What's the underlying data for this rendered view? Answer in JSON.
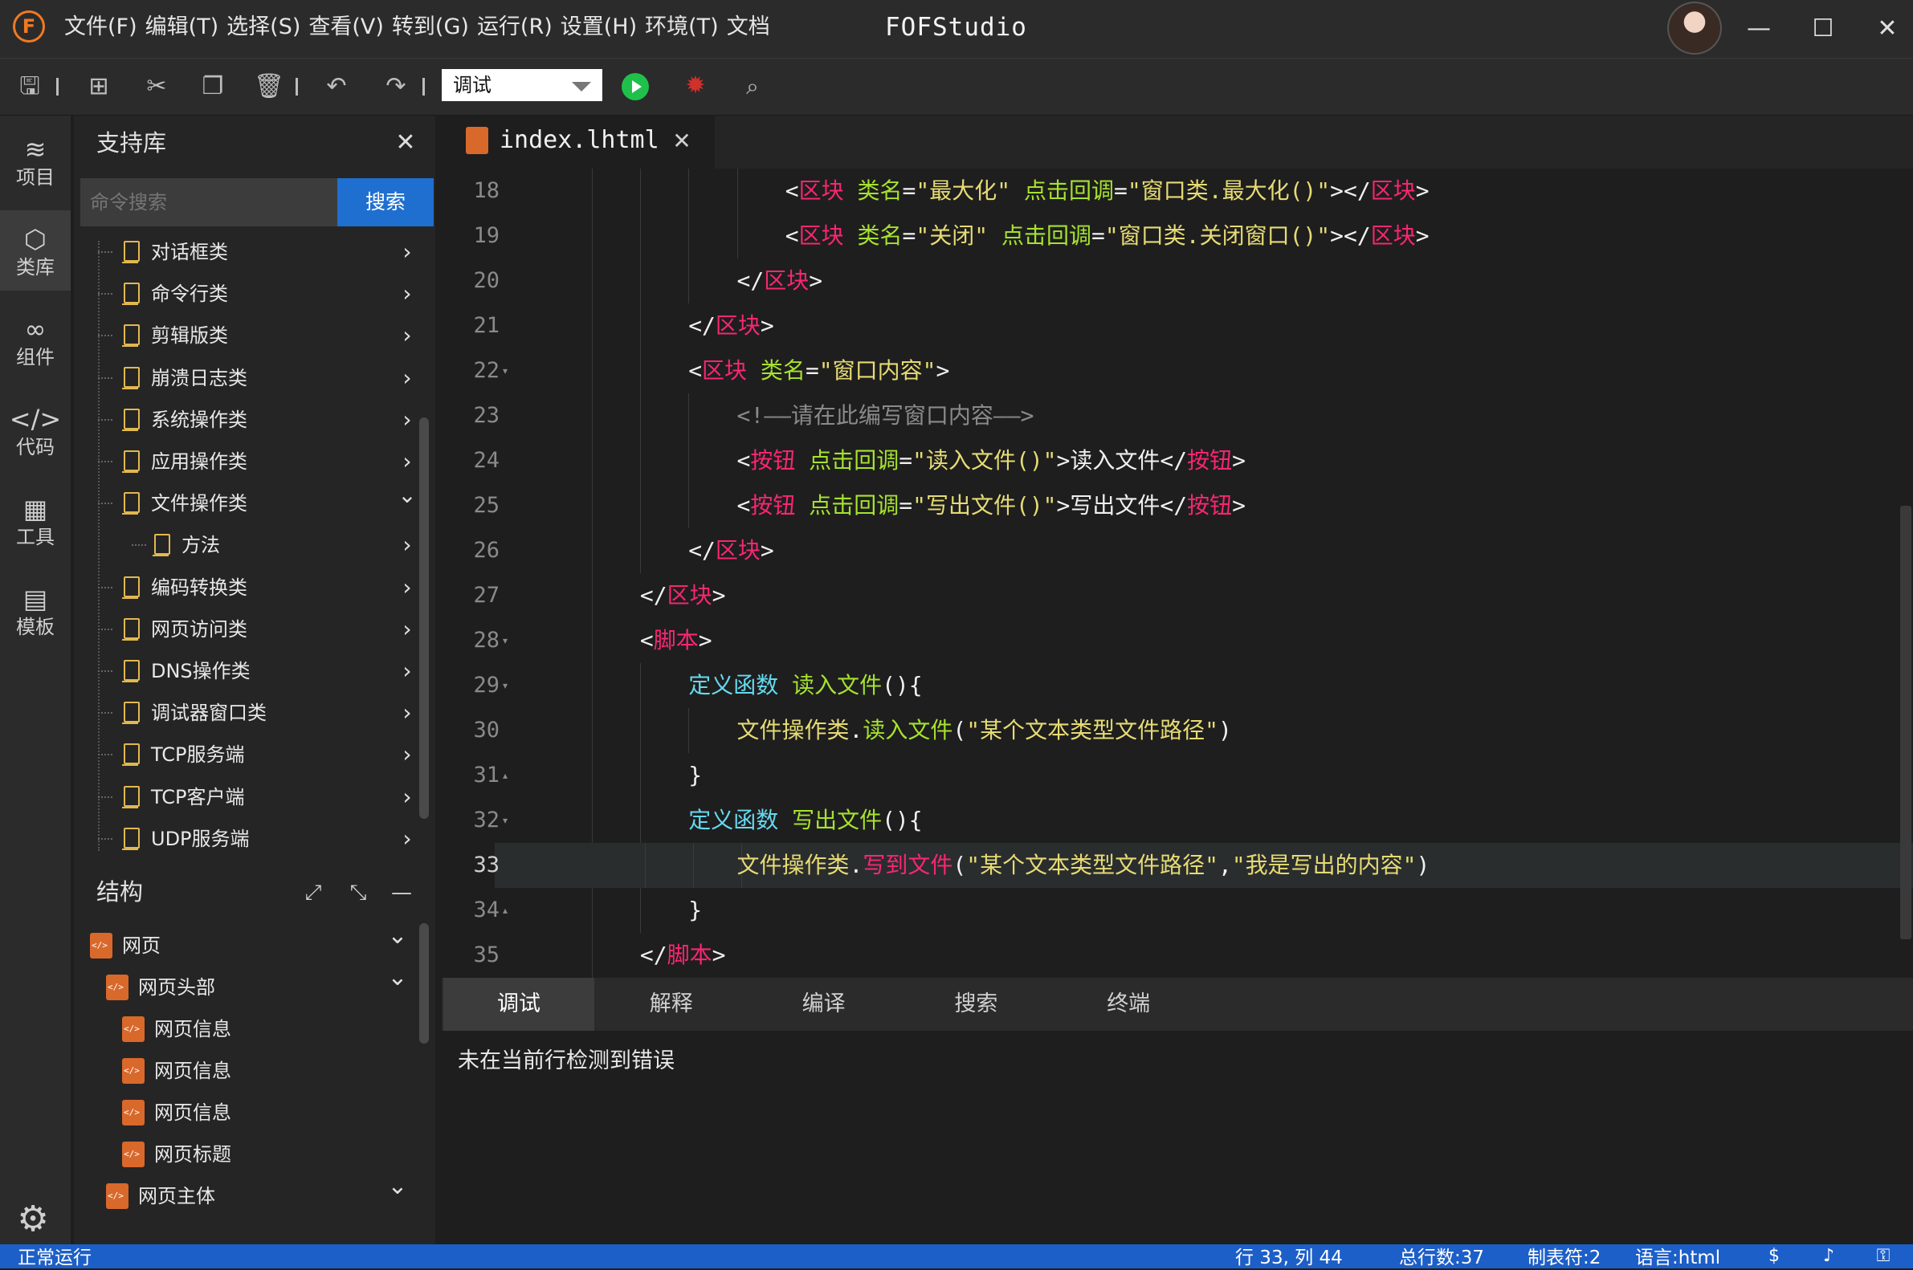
{
  "app": {
    "logo_letter": "F",
    "title": "FOFStudio",
    "menu": [
      "文件(F)",
      "编辑(T)",
      "选择(S)",
      "查看(V)",
      "转到(G)",
      "运行(R)",
      "设置(H)",
      "环境(T)",
      "文档"
    ]
  },
  "toolbar": {
    "run_mode": "调试"
  },
  "activity": [
    {
      "label": "项目",
      "icon": "layers-icon"
    },
    {
      "label": "类库",
      "icon": "cube-icon"
    },
    {
      "label": "组件",
      "icon": "link-icon"
    },
    {
      "label": "代码",
      "icon": "code-icon"
    },
    {
      "label": "工具",
      "icon": "tools-icon"
    },
    {
      "label": "模板",
      "icon": "template-icon"
    }
  ],
  "library": {
    "title": "支持库",
    "search_placeholder": "命令搜索",
    "search_button": "搜索",
    "items": [
      {
        "label": "对话框类",
        "expanded": false
      },
      {
        "label": "命令行类",
        "expanded": false
      },
      {
        "label": "剪辑版类",
        "expanded": false
      },
      {
        "label": "崩溃日志类",
        "expanded": false
      },
      {
        "label": "系统操作类",
        "expanded": false
      },
      {
        "label": "应用操作类",
        "expanded": false
      },
      {
        "label": "文件操作类",
        "expanded": true
      },
      {
        "label": "方法",
        "expanded": false,
        "child": true
      },
      {
        "label": "编码转换类",
        "expanded": false
      },
      {
        "label": "网页访问类",
        "expanded": false
      },
      {
        "label": "DNS操作类",
        "expanded": false
      },
      {
        "label": "调试器窗口类",
        "expanded": false
      },
      {
        "label": "TCP服务端",
        "expanded": false
      },
      {
        "label": "TCP客户端",
        "expanded": false
      },
      {
        "label": "UDP服务端",
        "expanded": false
      }
    ]
  },
  "structure": {
    "title": "结构",
    "items": [
      {
        "label": "网页",
        "depth": 0,
        "expanded": true
      },
      {
        "label": "网页头部",
        "depth": 1,
        "expanded": true
      },
      {
        "label": "网页信息",
        "depth": 2
      },
      {
        "label": "网页信息",
        "depth": 2
      },
      {
        "label": "网页信息",
        "depth": 2
      },
      {
        "label": "网页标题",
        "depth": 2
      },
      {
        "label": "网页主体",
        "depth": 1,
        "expanded": true
      }
    ]
  },
  "editor": {
    "tab": "index.lhtml",
    "current_line": 33,
    "lines": [
      {
        "n": 18,
        "fold": "",
        "indent": 6,
        "tokens": [
          [
            "w",
            "<"
          ],
          [
            "r",
            "区块"
          ],
          [
            "w",
            " "
          ],
          [
            "g",
            "类名"
          ],
          [
            "w",
            "="
          ],
          [
            "y",
            "\"最大化\""
          ],
          [
            "w",
            " "
          ],
          [
            "g",
            "点击回调"
          ],
          [
            "w",
            "="
          ],
          [
            "y",
            "\"窗口类.最大化()\""
          ],
          [
            "w",
            "></"
          ],
          [
            "r",
            "区块"
          ],
          [
            "w",
            ">"
          ]
        ]
      },
      {
        "n": 19,
        "fold": "",
        "indent": 6,
        "tokens": [
          [
            "w",
            "<"
          ],
          [
            "r",
            "区块"
          ],
          [
            "w",
            " "
          ],
          [
            "g",
            "类名"
          ],
          [
            "w",
            "="
          ],
          [
            "y",
            "\"关闭\""
          ],
          [
            "w",
            " "
          ],
          [
            "g",
            "点击回调"
          ],
          [
            "w",
            "="
          ],
          [
            "y",
            "\"窗口类.关闭窗口()\""
          ],
          [
            "w",
            "></"
          ],
          [
            "r",
            "区块"
          ],
          [
            "w",
            ">"
          ]
        ]
      },
      {
        "n": 20,
        "fold": "",
        "indent": 5,
        "tokens": [
          [
            "w",
            "</"
          ],
          [
            "r",
            "区块"
          ],
          [
            "w",
            ">"
          ]
        ]
      },
      {
        "n": 21,
        "fold": "",
        "indent": 4,
        "tokens": [
          [
            "w",
            "</"
          ],
          [
            "r",
            "区块"
          ],
          [
            "w",
            ">"
          ]
        ]
      },
      {
        "n": 22,
        "fold": "▾",
        "indent": 4,
        "tokens": [
          [
            "w",
            "<"
          ],
          [
            "r",
            "区块"
          ],
          [
            "w",
            " "
          ],
          [
            "g",
            "类名"
          ],
          [
            "w",
            "="
          ],
          [
            "y",
            "\"窗口内容\""
          ],
          [
            "w",
            ">"
          ]
        ]
      },
      {
        "n": 23,
        "fold": "",
        "indent": 5,
        "tokens": [
          [
            "m",
            "<!——请在此编写窗口内容——>"
          ]
        ]
      },
      {
        "n": 24,
        "fold": "",
        "indent": 5,
        "tokens": [
          [
            "w",
            "<"
          ],
          [
            "r",
            "按钮"
          ],
          [
            "w",
            " "
          ],
          [
            "g",
            "点击回调"
          ],
          [
            "w",
            "="
          ],
          [
            "y",
            "\"读入文件()\""
          ],
          [
            "w",
            ">读入文件</"
          ],
          [
            "r",
            "按钮"
          ],
          [
            "w",
            ">"
          ]
        ]
      },
      {
        "n": 25,
        "fold": "",
        "indent": 5,
        "tokens": [
          [
            "w",
            "<"
          ],
          [
            "r",
            "按钮"
          ],
          [
            "w",
            " "
          ],
          [
            "g",
            "点击回调"
          ],
          [
            "w",
            "="
          ],
          [
            "y",
            "\"写出文件()\""
          ],
          [
            "w",
            ">写出文件</"
          ],
          [
            "r",
            "按钮"
          ],
          [
            "w",
            ">"
          ]
        ]
      },
      {
        "n": 26,
        "fold": "",
        "indent": 4,
        "tokens": [
          [
            "w",
            "</"
          ],
          [
            "r",
            "区块"
          ],
          [
            "w",
            ">"
          ]
        ]
      },
      {
        "n": 27,
        "fold": "",
        "indent": 3,
        "tokens": [
          [
            "w",
            "</"
          ],
          [
            "r",
            "区块"
          ],
          [
            "w",
            ">"
          ]
        ]
      },
      {
        "n": 28,
        "fold": "▾",
        "indent": 3,
        "tokens": [
          [
            "w",
            "<"
          ],
          [
            "r",
            "脚本"
          ],
          [
            "w",
            ">"
          ]
        ]
      },
      {
        "n": 29,
        "fold": "▾",
        "indent": 4,
        "tokens": [
          [
            "c",
            "定义函数"
          ],
          [
            "w",
            " "
          ],
          [
            "g",
            "读入文件"
          ],
          [
            "w",
            "(){"
          ]
        ]
      },
      {
        "n": 30,
        "fold": "",
        "indent": 5,
        "tokens": [
          [
            "y",
            "文件操作类"
          ],
          [
            "w",
            "."
          ],
          [
            "g",
            "读入文件"
          ],
          [
            "w",
            "("
          ],
          [
            "y",
            "\"某个文本类型文件路径\""
          ],
          [
            "w",
            ")"
          ]
        ]
      },
      {
        "n": 31,
        "fold": "▴",
        "indent": 4,
        "tokens": [
          [
            "w",
            "}"
          ]
        ]
      },
      {
        "n": 32,
        "fold": "▾",
        "indent": 4,
        "tokens": [
          [
            "c",
            "定义函数"
          ],
          [
            "w",
            " "
          ],
          [
            "g",
            "写出文件"
          ],
          [
            "w",
            "(){"
          ]
        ]
      },
      {
        "n": 33,
        "fold": "",
        "indent": 5,
        "tokens": [
          [
            "y",
            "文件操作类"
          ],
          [
            "w",
            "."
          ],
          [
            "r",
            "写到文件"
          ],
          [
            "w",
            "("
          ],
          [
            "y",
            "\"某个文本类型文件路径\""
          ],
          [
            "w",
            ","
          ],
          [
            "y",
            "\"我是写出的内容\""
          ],
          [
            "w",
            ")"
          ]
        ]
      },
      {
        "n": 34,
        "fold": "▴",
        "indent": 4,
        "tokens": [
          [
            "w",
            "}"
          ]
        ]
      },
      {
        "n": 35,
        "fold": "",
        "indent": 3,
        "tokens": [
          [
            "w",
            "</"
          ],
          [
            "r",
            "脚本"
          ],
          [
            "w",
            ">"
          ]
        ]
      }
    ]
  },
  "bottom": {
    "tabs": [
      "调试",
      "解释",
      "编译",
      "搜索",
      "终端"
    ],
    "active": 0,
    "message": "未在当前行检测到错误"
  },
  "status": {
    "left": "正常运行",
    "position": "行 33, 列 44",
    "total_lines": "总行数:37",
    "tab_size": "制表符:2",
    "language": "语言:html"
  },
  "colors": {
    "accent": "#1f6fd0",
    "run_green": "#20c14a",
    "debug_red": "#d0312d",
    "status_bar": "#1d5fc8"
  }
}
